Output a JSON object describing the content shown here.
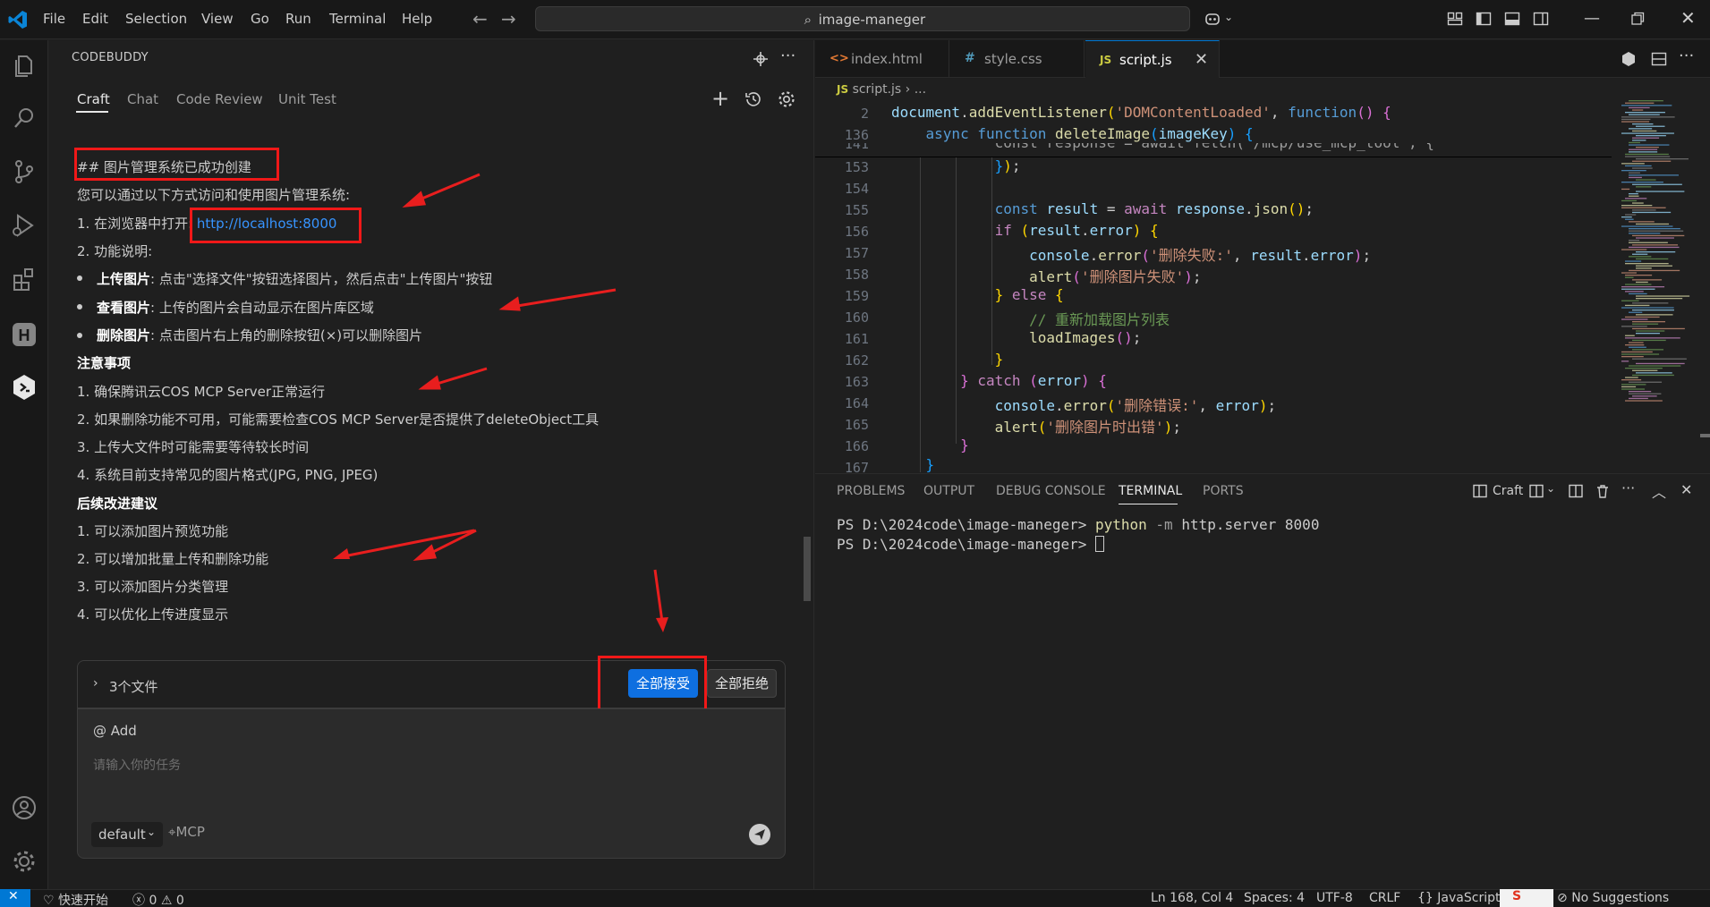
{
  "titlebar": {
    "menus": [
      "File",
      "Edit",
      "Selection",
      "View",
      "Go",
      "Run",
      "Terminal",
      "Help"
    ],
    "search_text": "image-maneger"
  },
  "codebuddy": {
    "title": "CODEBUDDY",
    "tabs": [
      "Craft",
      "Chat",
      "Code Review",
      "Unit Test"
    ],
    "heading": "## 图片管理系统已成功创建",
    "intro": "您可以通过以下方式访问和使用图片管理系统:",
    "step1_prefix": "1. 在浏览器中打开: ",
    "step1_link": "http://localhost:8000",
    "step2": "2. 功能说明:",
    "bullets": [
      {
        "bold": "上传图片",
        "text": ": 点击\"选择文件\"按钮选择图片，然后点击\"上传图片\"按钮"
      },
      {
        "bold": "查看图片",
        "text": ": 上传的图片会自动显示在图片库区域"
      },
      {
        "bold": "删除图片",
        "text": ": 点击图片右上角的删除按钮(×)可以删除图片"
      }
    ],
    "notes_title": "注意事项",
    "notes": [
      "1. 确保腾讯云COS MCP Server正常运行",
      "2. 如果删除功能不可用，可能需要检查COS MCP Server是否提供了deleteObject工具",
      "3. 上传大文件时可能需要等待较长时间",
      "4. 系统目前支持常见的图片格式(JPG, PNG, JPEG)"
    ],
    "improve_title": "后续改进建议",
    "improvements": [
      "1. 可以添加图片预览功能",
      "2. 可以增加批量上传和删除功能",
      "3. 可以添加图片分类管理",
      "4. 可以优化上传进度显示"
    ],
    "files_label": "3个文件",
    "accept_all": "全部接受",
    "reject_all": "全部拒绝",
    "add_label": "@ Add",
    "input_placeholder": "请输入你的任务",
    "mode": "default",
    "mcp_label": "MCP"
  },
  "editor": {
    "tabs": [
      {
        "icon": "<>",
        "label": "index.html"
      },
      {
        "icon": "#",
        "label": "style.css"
      },
      {
        "icon": "JS",
        "label": "script.js"
      }
    ],
    "breadcrumb": [
      "script.js",
      "..."
    ],
    "sticky_lines": [
      {
        "num": "2",
        "text": "document.addEventListener('DOMContentLoaded', function() {"
      },
      {
        "num": "136",
        "text": "    async function deleteImage(imageKey) {"
      }
    ],
    "clipped_line": {
      "num": "141",
      "text": "            const response = await fetch('/mcp/use_mcp_tool', {"
    },
    "lines": [
      {
        "num": "153",
        "text": "            });"
      },
      {
        "num": "154",
        "text": ""
      },
      {
        "num": "155",
        "text": "            const result = await response.json();"
      },
      {
        "num": "156",
        "text": "            if (result.error) {"
      },
      {
        "num": "157",
        "text": "                console.error('删除失败:', result.error);"
      },
      {
        "num": "158",
        "text": "                alert('删除图片失败');"
      },
      {
        "num": "159",
        "text": "            } else {"
      },
      {
        "num": "160",
        "text": "                // 重新加载图片列表"
      },
      {
        "num": "161",
        "text": "                loadImages();"
      },
      {
        "num": "162",
        "text": "            }"
      },
      {
        "num": "163",
        "text": "        } catch (error) {"
      },
      {
        "num": "164",
        "text": "            console.error('删除错误:', error);"
      },
      {
        "num": "165",
        "text": "            alert('删除图片时出错');"
      },
      {
        "num": "166",
        "text": "        }"
      },
      {
        "num": "167",
        "text": "    }"
      }
    ]
  },
  "panel": {
    "tabs": [
      "PROBLEMS",
      "OUTPUT",
      "DEBUG CONSOLE",
      "TERMINAL",
      "PORTS"
    ],
    "terminal_name": "Craft",
    "terminal_lines": [
      {
        "prompt": "PS D:\\2024code\\image-maneger> ",
        "cmd": "python",
        "flag": " -m",
        "args": " http.server 8000"
      },
      {
        "prompt": "PS D:\\2024code\\image-maneger> ",
        "cmd": "",
        "flag": "",
        "args": ""
      }
    ]
  },
  "statusbar": {
    "branch": "快速开始",
    "errors": "0",
    "warnings": "0",
    "position": "Ln 168, Col 4",
    "spaces": "Spaces: 4",
    "encoding": "UTF-8",
    "eol": "CRLF",
    "language": "JavaScript",
    "suggestions": "No Suggestions"
  }
}
